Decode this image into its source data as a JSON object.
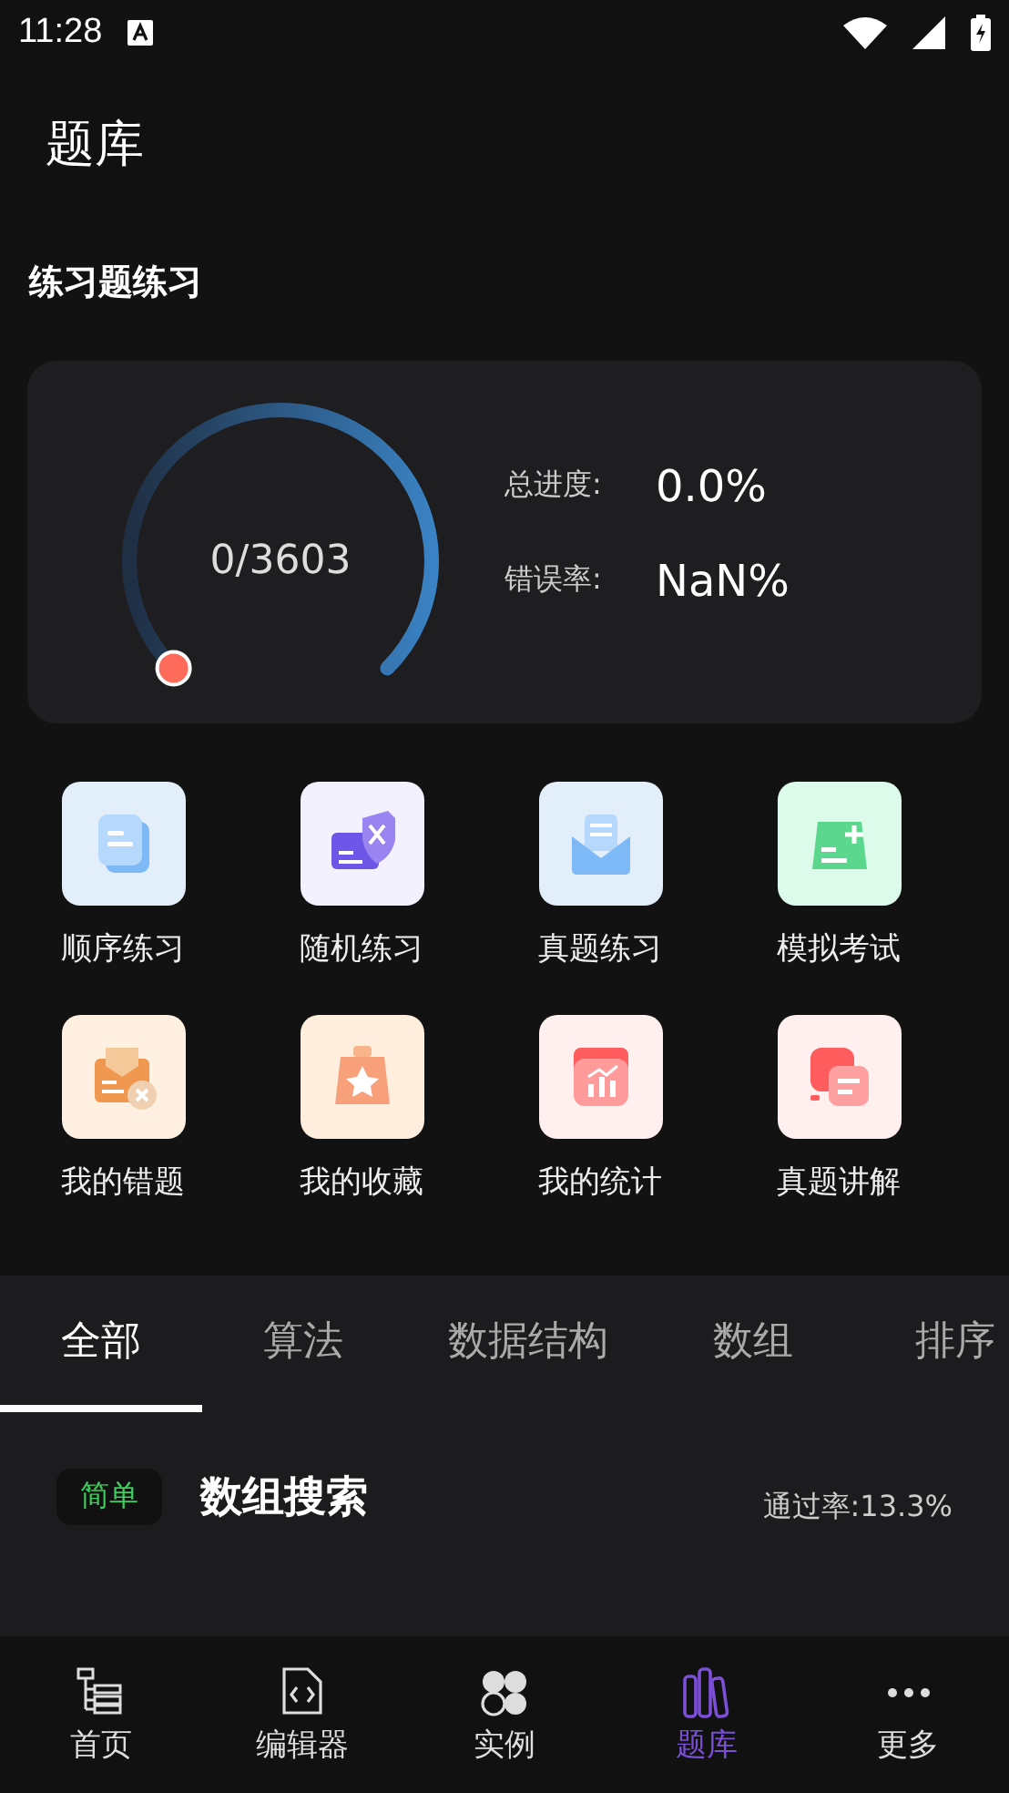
{
  "status_bar": {
    "time": "11:28"
  },
  "header": {
    "title": "题库"
  },
  "practice": {
    "title": "练习题练习",
    "gauge": {
      "count": "0/3603"
    },
    "stats": [
      {
        "label": "总进度:",
        "value": "0.0%"
      },
      {
        "label": "错误率:",
        "value": "NaN%"
      }
    ]
  },
  "shortcuts": [
    {
      "label": "顺序练习"
    },
    {
      "label": "随机练习"
    },
    {
      "label": "真题练习"
    },
    {
      "label": "模拟考试"
    },
    {
      "label": "我的错题"
    },
    {
      "label": "我的收藏"
    },
    {
      "label": "我的统计"
    },
    {
      "label": "真题讲解"
    }
  ],
  "tabs": [
    {
      "label": "全部",
      "selected": true
    },
    {
      "label": "算法",
      "selected": false
    },
    {
      "label": "数据结构",
      "selected": false
    },
    {
      "label": "数组",
      "selected": false
    },
    {
      "label": "排序",
      "selected": false
    }
  ],
  "questions": [
    {
      "difficulty": "简单",
      "title": "数组搜索",
      "pass_rate": "通过率:13.3%"
    }
  ],
  "bottom_nav": [
    {
      "label": "首页",
      "selected": false
    },
    {
      "label": "编辑器",
      "selected": false
    },
    {
      "label": "实例",
      "selected": false
    },
    {
      "label": "题库",
      "selected": true
    },
    {
      "label": "更多",
      "selected": false
    }
  ]
}
